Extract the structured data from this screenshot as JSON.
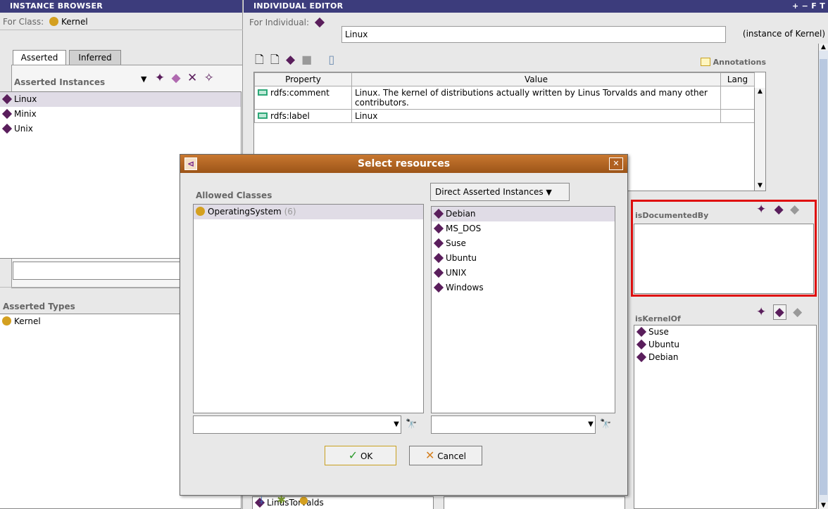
{
  "instance_browser": {
    "title": "INSTANCE BROWSER",
    "for_class_label": "For Class:",
    "class_name": "Kernel",
    "tabs": [
      {
        "label": "Asserted"
      },
      {
        "label": "Inferred"
      }
    ],
    "asserted_instances_label": "Asserted Instances",
    "instances": [
      {
        "label": "Linux"
      },
      {
        "label": "Minix"
      },
      {
        "label": "Unix"
      }
    ],
    "asserted_types_label": "Asserted Types",
    "types": [
      {
        "label": "Kernel"
      }
    ]
  },
  "individual_editor": {
    "title": "INDIVIDUAL EDITOR",
    "title_controls": "+ − F T",
    "for_individual_label": "For Individual:",
    "individual_name": "Linux",
    "instance_of": "(instance of Kernel)",
    "annotations_label": "Annotations",
    "table": {
      "headers": [
        "Property",
        "Value",
        "Lang"
      ],
      "rows": [
        {
          "property": "rdfs:comment",
          "value": "Linux. The kernel of distributions actually written by Linus Torvalds and many other contributors.",
          "lang": ""
        },
        {
          "property": "rdfs:label",
          "value": "Linux",
          "lang": ""
        }
      ]
    },
    "is_documented_by_label": "isDocumentedBy",
    "is_kernel_of_label": "isKernelOf",
    "is_kernel_of_items": [
      {
        "label": "Suse"
      },
      {
        "label": "Ubuntu"
      },
      {
        "label": "Debian"
      }
    ],
    "bottom_list_item": "LinusTorvalds"
  },
  "dialog": {
    "title": "Select resources",
    "close_glyph": "✕",
    "allowed_classes_label": "Allowed Classes",
    "classes": [
      {
        "label": "OperatingSystem",
        "count": "(6)"
      }
    ],
    "filter_dropdown": "Direct Asserted Instances",
    "instances": [
      {
        "label": "Debian"
      },
      {
        "label": "MS_DOS"
      },
      {
        "label": "Suse"
      },
      {
        "label": "Ubuntu"
      },
      {
        "label": "UNIX"
      },
      {
        "label": "Windows"
      }
    ],
    "ok_label": "OK",
    "cancel_label": "Cancel"
  },
  "colors": {
    "accent": "#3c3c7c",
    "highlight_border": "#e01010",
    "instance_diamond": "#5a1e5c",
    "class_dot": "#d4a020"
  }
}
